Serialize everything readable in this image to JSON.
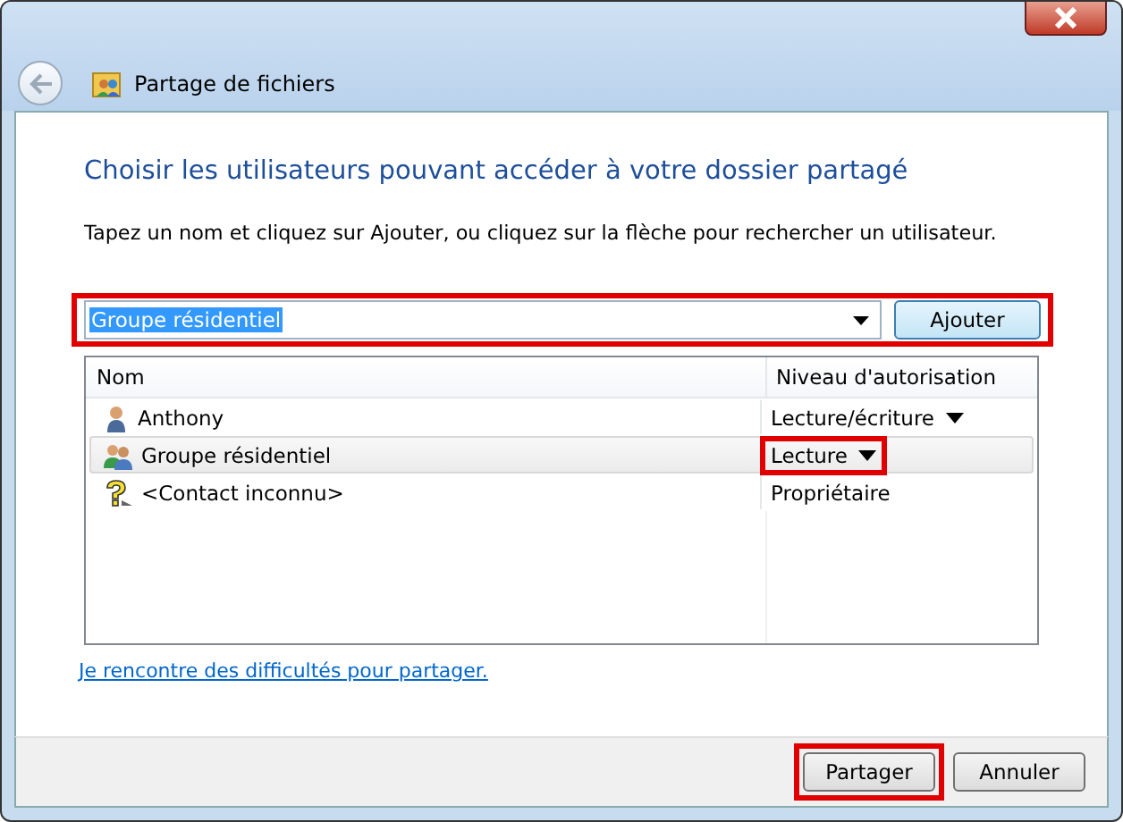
{
  "window": {
    "title": "Partage de fichiers"
  },
  "heading": "Choisir les utilisateurs pouvant accéder à votre dossier partagé",
  "instruction": "Tapez un nom et cliquez sur Ajouter, ou cliquez sur la flèche pour rechercher un utilisateur.",
  "entry": {
    "value": "Groupe résidentiel",
    "highlighted": true,
    "button": "Ajouter"
  },
  "table": {
    "columns": [
      "Nom",
      "Niveau d'autorisation"
    ],
    "rows": [
      {
        "name": "Anthony",
        "kind": "user",
        "permission": "Lecture/écriture",
        "dropdown": true,
        "selected": false,
        "highlighted": false
      },
      {
        "name": "Groupe résidentiel",
        "kind": "group",
        "permission": "Lecture",
        "dropdown": true,
        "selected": true,
        "highlighted": true
      },
      {
        "name": "<Contact inconnu>",
        "kind": "unknown",
        "permission": "Propriétaire",
        "dropdown": false,
        "selected": false,
        "highlighted": false
      }
    ]
  },
  "help_link": "Je rencontre des difficultés pour partager.",
  "buttons": [
    {
      "label": "Partager",
      "highlighted": true
    },
    {
      "label": "Annuler",
      "highlighted": false
    }
  ]
}
